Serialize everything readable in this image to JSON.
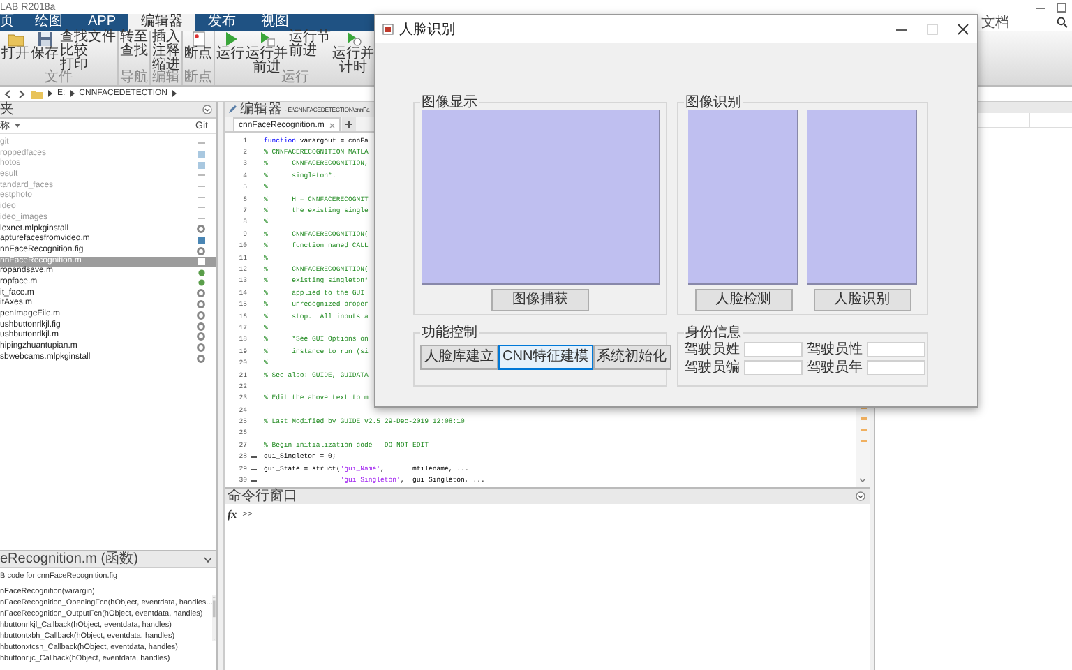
{
  "app_title": "LAB R2018a",
  "ribbon_tabs": [
    {
      "label": "页",
      "selected": false
    },
    {
      "label": "绘图",
      "selected": false
    },
    {
      "label": "APP",
      "selected": false
    },
    {
      "label": "编辑器",
      "selected": true
    },
    {
      "label": "发布",
      "selected": false
    },
    {
      "label": "视图",
      "selected": false
    }
  ],
  "doc_search": {
    "placeholder": "文档"
  },
  "ribbon": [
    {
      "label": "文件",
      "tools": [
        {
          "kind": "large",
          "label": "打开"
        },
        {
          "kind": "large",
          "label": "保存"
        },
        {
          "kind": "stack",
          "items": [
            "查找文件",
            "比较",
            "打印"
          ]
        }
      ]
    },
    {
      "label": "导航",
      "tools": [
        {
          "kind": "stack",
          "items": [
            "转至",
            "查找"
          ]
        }
      ]
    },
    {
      "label": "编辑",
      "tools": [
        {
          "kind": "stack",
          "items": [
            "插入",
            "注释",
            "缩进"
          ]
        }
      ]
    },
    {
      "label": "断点",
      "tools": [
        {
          "kind": "large",
          "label": "断点"
        }
      ]
    },
    {
      "label": "运行",
      "tools": [
        {
          "kind": "large",
          "label": "运行"
        },
        {
          "kind": "large",
          "label": "运行并前进"
        },
        {
          "kind": "stack",
          "items": [
            "运行节",
            "前进"
          ]
        },
        {
          "kind": "large",
          "label": "运行并计时"
        }
      ]
    }
  ],
  "address": {
    "segments": [
      "E:",
      "CNNFACEDETECTION"
    ]
  },
  "current_folder": {
    "title": "夹",
    "columns": [
      "称",
      "Git"
    ],
    "items": [
      {
        "name": "git",
        "on_path": false,
        "kind": "dash",
        "color": "#bbbbbb",
        "selected": false
      },
      {
        "name": "roppedfaces",
        "on_path": false,
        "kind": "square",
        "color": "#a9c8e0",
        "selected": false
      },
      {
        "name": "hotos",
        "on_path": false,
        "kind": "square",
        "color": "#a9c8e0",
        "selected": false
      },
      {
        "name": "esult",
        "on_path": false,
        "kind": "dash",
        "color": "#bbbbbb",
        "selected": false
      },
      {
        "name": "tandard_faces",
        "on_path": false,
        "kind": "dash",
        "color": "#bbbbbb",
        "selected": false
      },
      {
        "name": "estphoto",
        "on_path": false,
        "kind": "dash",
        "color": "#bbbbbb",
        "selected": false
      },
      {
        "name": "ideo",
        "on_path": false,
        "kind": "dash",
        "color": "#bbbbbb",
        "selected": false
      },
      {
        "name": "ideo_images",
        "on_path": false,
        "kind": "dash",
        "color": "#bbbbbb",
        "selected": false
      },
      {
        "name": "lexnet.mlpkginstall",
        "on_path": true,
        "kind": "circle",
        "color": "#888888",
        "selected": false
      },
      {
        "name": "apturefacesfromvideo.m",
        "on_path": true,
        "kind": "square",
        "color": "#4a86b4",
        "selected": false
      },
      {
        "name": "nnFaceRecognition.fig",
        "on_path": true,
        "kind": "circle",
        "color": "#888888",
        "selected": false
      },
      {
        "name": "nnFaceRecognition.m",
        "on_path": true,
        "kind": "square",
        "color": "#ffffff",
        "selected": true
      },
      {
        "name": "ropandsave.m",
        "on_path": true,
        "kind": "dot",
        "color": "#5a9e4a",
        "selected": false
      },
      {
        "name": "ropface.m",
        "on_path": true,
        "kind": "dot",
        "color": "#5a9e4a",
        "selected": false
      },
      {
        "name": "it_face.m",
        "on_path": true,
        "kind": "circle",
        "color": "#888888",
        "selected": false
      },
      {
        "name": "itAxes.m",
        "on_path": true,
        "kind": "circle",
        "color": "#888888",
        "selected": false
      },
      {
        "name": "penImageFile.m",
        "on_path": true,
        "kind": "circle",
        "color": "#888888",
        "selected": false
      },
      {
        "name": "ushbuttonrlkjl.fig",
        "on_path": true,
        "kind": "circle",
        "color": "#888888",
        "selected": false
      },
      {
        "name": "ushbuttonrlkjl.m",
        "on_path": true,
        "kind": "circle",
        "color": "#888888",
        "selected": false
      },
      {
        "name": "hipingzhuantupian.m",
        "on_path": true,
        "kind": "circle",
        "color": "#888888",
        "selected": false
      },
      {
        "name": "sbwebcams.mlpkginstall",
        "on_path": true,
        "kind": "circle",
        "color": "#888888",
        "selected": false
      }
    ]
  },
  "details": {
    "title": "eRecognition.m (函数)",
    "lines": [
      "B code for cnnFaceRecognition.fig",
      "nFaceRecognition(varargin)",
      "nFaceRecognition_OpeningFcn(hObject, eventdata, handles...",
      "nFaceRecognition_OutputFcn(hObject, eventdata, handles)",
      "hbuttonrlkjl_Callback(hObject, eventdata, handles)",
      "hbuttontxbh_Callback(hObject, eventdata, handles)",
      "hbuttonxtcsh_Callback(hObject, eventdata, handles)",
      "hbuttonrljc_Callback(hObject, eventdata, handles)"
    ]
  },
  "editor": {
    "title": "编辑器",
    "path": "- E:\\CNNFACEDETECTION\\cnnFa",
    "tabs": [
      {
        "label": "cnnFaceRecognition.m",
        "selected": true
      }
    ],
    "lines": [
      {
        "number": "1",
        "executable": false,
        "parts": [
          {
            "kind": "keyword",
            "text": "function"
          },
          {
            "kind": "code",
            "text": " varargout = cnnFa"
          }
        ]
      },
      {
        "number": "2",
        "executable": false,
        "parts": [
          {
            "kind": "comment",
            "text": "% CNNFACERECOGNITION MATLA"
          }
        ]
      },
      {
        "number": "3",
        "executable": false,
        "parts": [
          {
            "kind": "comment",
            "text": "%      CNNFACERECOGNITION,"
          }
        ]
      },
      {
        "number": "4",
        "executable": false,
        "parts": [
          {
            "kind": "comment",
            "text": "%      singleton*."
          }
        ]
      },
      {
        "number": "5",
        "executable": false,
        "parts": [
          {
            "kind": "comment",
            "text": "%"
          }
        ]
      },
      {
        "number": "6",
        "executable": false,
        "parts": [
          {
            "kind": "comment",
            "text": "%      H = CNNFACERECOGNIT"
          }
        ]
      },
      {
        "number": "7",
        "executable": false,
        "parts": [
          {
            "kind": "comment",
            "text": "%      the existing single"
          }
        ]
      },
      {
        "number": "8",
        "executable": false,
        "parts": [
          {
            "kind": "comment",
            "text": "%"
          }
        ]
      },
      {
        "number": "9",
        "executable": false,
        "parts": [
          {
            "kind": "comment",
            "text": "%      CNNFACERECOGNITION("
          }
        ]
      },
      {
        "number": "10",
        "executable": false,
        "parts": [
          {
            "kind": "comment",
            "text": "%      function named CALL"
          }
        ]
      },
      {
        "number": "11",
        "executable": false,
        "parts": [
          {
            "kind": "comment",
            "text": "%"
          }
        ]
      },
      {
        "number": "12",
        "executable": false,
        "parts": [
          {
            "kind": "comment",
            "text": "%      CNNFACERECOGNITION("
          }
        ]
      },
      {
        "number": "13",
        "executable": false,
        "parts": [
          {
            "kind": "comment",
            "text": "%      existing singleton*"
          }
        ]
      },
      {
        "number": "14",
        "executable": false,
        "parts": [
          {
            "kind": "comment",
            "text": "%      applied to the GUI"
          }
        ]
      },
      {
        "number": "15",
        "executable": false,
        "parts": [
          {
            "kind": "comment",
            "text": "%      unrecognized proper"
          }
        ]
      },
      {
        "number": "16",
        "executable": false,
        "parts": [
          {
            "kind": "comment",
            "text": "%      stop.  All inputs a"
          }
        ]
      },
      {
        "number": "17",
        "executable": false,
        "parts": [
          {
            "kind": "comment",
            "text": "%"
          }
        ]
      },
      {
        "number": "18",
        "executable": false,
        "parts": [
          {
            "kind": "comment",
            "text": "%      *See GUI Options on"
          }
        ]
      },
      {
        "number": "19",
        "executable": false,
        "parts": [
          {
            "kind": "comment",
            "text": "%      instance to run (si"
          }
        ]
      },
      {
        "number": "20",
        "executable": false,
        "parts": [
          {
            "kind": "comment",
            "text": "%"
          }
        ]
      },
      {
        "number": "21",
        "executable": false,
        "parts": [
          {
            "kind": "comment",
            "text": "% See also: GUIDE, GUIDATA"
          }
        ]
      },
      {
        "number": "22",
        "executable": false
      },
      {
        "number": "23",
        "executable": false,
        "parts": [
          {
            "kind": "comment",
            "text": "% Edit the above text to m"
          }
        ]
      },
      {
        "number": "24",
        "executable": false
      },
      {
        "number": "25",
        "executable": false,
        "parts": [
          {
            "kind": "comment",
            "text": "% Last Modified by GUIDE v2.5 29-Dec-2019 12:08:10"
          }
        ]
      },
      {
        "number": "26",
        "executable": false
      },
      {
        "number": "27",
        "executable": false,
        "parts": [
          {
            "kind": "comment",
            "text": "% Begin initialization code - DO NOT EDIT"
          }
        ]
      },
      {
        "number": "28",
        "executable": true,
        "parts": [
          {
            "kind": "code",
            "text": "gui_Singleton = 0;"
          }
        ]
      },
      {
        "number": "29",
        "executable": true,
        "parts": [
          {
            "kind": "code",
            "text": "gui_State = struct("
          },
          {
            "kind": "string",
            "text": "'gui_Name'"
          },
          {
            "kind": "code",
            "text": ",       mfilename, ..."
          }
        ]
      },
      {
        "number": "30",
        "executable": true,
        "parts": [
          {
            "kind": "string",
            "text": "                   'gui_Singleton'"
          },
          {
            "kind": "code",
            "text": ",  gui_Singleton, ..."
          }
        ]
      }
    ]
  },
  "command_window": {
    "title": "命令行窗口",
    "function_hint": "fx",
    "prompt": ">>"
  },
  "dialog": {
    "title": "人脸识别",
    "image_display": {
      "title": "图像显示",
      "button": {
        "label": "图像捕获",
        "focused": false
      }
    },
    "image_recognition": {
      "title": "图像识别",
      "buttons": [
        {
          "label": "人脸检测",
          "focused": false
        },
        {
          "label": "人脸识别",
          "focused": false
        }
      ]
    },
    "function_control": {
      "title": "功能控制",
      "buttons": [
        {
          "label": "人脸库建立",
          "focused": false
        },
        {
          "label": "CNN特征建模",
          "focused": true
        },
        {
          "label": "系统初始化",
          "focused": false
        }
      ]
    },
    "identity_info": {
      "title": "身份信息",
      "fields": [
        {
          "label": "驾驶员姓"
        },
        {
          "label": "驾驶员性"
        },
        {
          "label": "驾驶员编"
        },
        {
          "label": "驾驶员年"
        }
      ]
    }
  }
}
